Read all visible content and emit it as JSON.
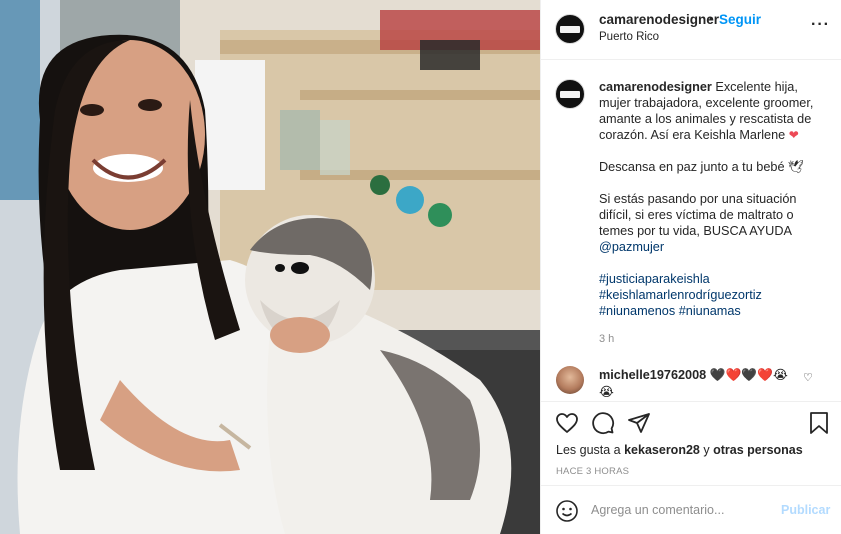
{
  "post": {
    "username": "camarenodesigner",
    "dot": "•",
    "follow_label": "Seguir",
    "location": "Puerto Rico",
    "more_label": "···"
  },
  "caption": {
    "username": "camarenodesigner",
    "text_1": " Excelente hija, mujer trabajadora, excelente groomer, amante a los animales y rescatista de corazón. Así era Keishla Marlene ",
    "heart": "❤",
    "text_2": "Descansa en paz junto a tu bebé 🕊",
    "text_3": "Si estás pasando por una situación difícil, si eres víctima de maltrato o temes por tu vida, BUSCA AYUDA ",
    "mention": "@pazmujer",
    "hashtags": [
      "#justiciaparakeishla",
      "#keishlamarlenrodríguezortiz",
      "#niunamenos #niunamas"
    ],
    "time": "3 h"
  },
  "comment": {
    "username": "michelle19762008",
    "text": " 🖤❤️🖤❤️😭😭",
    "like_icon": "♡"
  },
  "actions": {
    "likes_prefix": "Les gusta a ",
    "likes_user": "kekaseron28",
    "likes_mid": " y ",
    "likes_rest": "otras personas",
    "ago": "HACE 3 HORAS"
  },
  "add_comment": {
    "placeholder": "Agrega un comentario...",
    "publish_label": "Publicar"
  },
  "icons": {
    "like": "heart-icon",
    "comment": "comment-icon",
    "share": "share-icon",
    "save": "bookmark-icon",
    "emoji": "emoji-icon"
  },
  "colors": {
    "link_blue": "#0095f6",
    "mention_blue": "#00376b",
    "publish_disabled": "#b3dbff",
    "muted": "#8e8e8e"
  }
}
